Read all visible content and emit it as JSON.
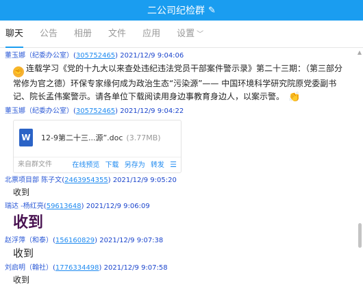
{
  "window": {
    "title": "二公司纪检群",
    "edit_icon": "pencil-icon"
  },
  "tabs": [
    {
      "label": "聊天",
      "active": true
    },
    {
      "label": "公告"
    },
    {
      "label": "相册"
    },
    {
      "label": "文件"
    },
    {
      "label": "应用"
    },
    {
      "label": "设置",
      "dropdown": true
    }
  ],
  "messages": [
    {
      "sender": "董玉娜（纪委办公室）",
      "qq": "305752465",
      "time": "2021/12/9 9:04:06",
      "text": "连载学习《党的十九大以来查处违纪违法党员干部案件警示录》第二十三期：（第三部分  常修为官之德）环保专家缘何成为政治生态“污染源”—— 中国环境科学研究院原党委副书记、院长孟伟案警示。请各单位下载阅读用身边事教育身边人，以案示警。"
    },
    {
      "sender": "董玉娜（纪委办公室）",
      "qq": "305752465",
      "time": "2021/12/9 9:04:22",
      "file": {
        "name": "12-9第二十三...源”.doc",
        "size": "(3.77MB)",
        "source": "来自群文件",
        "actions": [
          "在线预览",
          "下载",
          "另存为",
          "转发"
        ]
      }
    },
    {
      "sender": "北票项目部 陈子文",
      "qq": "2463954355",
      "time": "2021/12/9 9:05:20",
      "text": "收到"
    },
    {
      "sender": "瑞达 -杨红亮",
      "qq": "59613648",
      "time": "2021/12/9 9:06:09",
      "text": "收到"
    },
    {
      "sender": "赵浮萍（和泰）",
      "qq": "156160829",
      "time": "2021/12/9 9:07:38",
      "text": "收到"
    },
    {
      "sender": "刘启明（翰社）",
      "qq": "1776334498",
      "time": "2021/12/9 9:07:58",
      "text": "收到"
    }
  ]
}
